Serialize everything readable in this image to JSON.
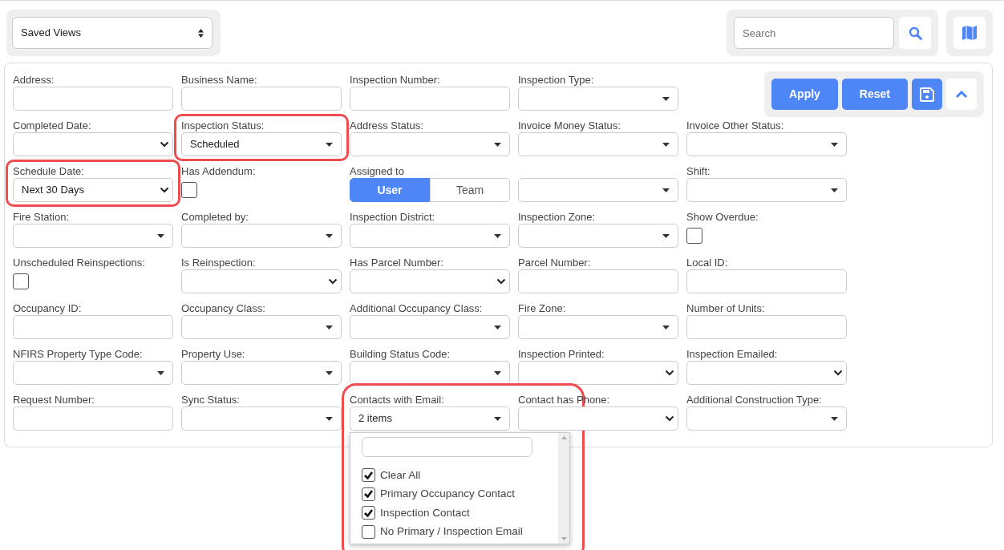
{
  "toolbar": {
    "saved_views": {
      "value": "Saved Views"
    },
    "search": {
      "placeholder": "Search"
    }
  },
  "filters": {
    "rows": [
      [
        {
          "label": "Address:",
          "kind": "text"
        },
        {
          "label": "Business Name:",
          "kind": "text"
        },
        {
          "label": "Inspection Number:",
          "kind": "text"
        },
        {
          "label": "Inspection Type:",
          "kind": "select"
        }
      ],
      [
        {
          "label": "Completed Date:",
          "kind": "native"
        },
        {
          "label": "Inspection Status:",
          "kind": "select",
          "value": "Scheduled",
          "highlighted": true
        },
        {
          "label": "Address Status:",
          "kind": "select"
        },
        {
          "label": "Invoice Money Status:",
          "kind": "select"
        },
        {
          "label": "Invoice Other Status:",
          "kind": "select"
        }
      ],
      [
        {
          "label": "Schedule Date:",
          "kind": "native",
          "value": "Next 30 Days",
          "highlighted": true
        },
        {
          "label": "Has Addendum:",
          "kind": "checkbox",
          "checked": false
        },
        {
          "label": "Assigned to",
          "kind": "toggle",
          "options": [
            {
              "label": "User",
              "selected": true
            },
            {
              "label": "Team",
              "selected": false
            }
          ]
        },
        {
          "kind": "select"
        },
        {
          "label": "Shift:",
          "kind": "select"
        }
      ],
      [
        {
          "label": "Fire Station:",
          "kind": "select"
        },
        {
          "label": "Completed by:",
          "kind": "select"
        },
        {
          "label": "Inspection District:",
          "kind": "select"
        },
        {
          "label": "Inspection Zone:",
          "kind": "select"
        },
        {
          "label": "Show Overdue:",
          "kind": "checkbox",
          "checked": false
        }
      ],
      [
        {
          "label": "Unscheduled Reinspections:",
          "kind": "checkbox",
          "checked": false
        },
        {
          "label": "Is Reinspection:",
          "kind": "native"
        },
        {
          "label": "Has Parcel Number:",
          "kind": "native"
        },
        {
          "label": "Parcel Number:",
          "kind": "text"
        },
        {
          "label": "Local ID:",
          "kind": "text"
        }
      ],
      [
        {
          "label": "Occupancy ID:",
          "kind": "text"
        },
        {
          "label": "Occupancy Class:",
          "kind": "select"
        },
        {
          "label": "Additional Occupancy Class:",
          "kind": "select"
        },
        {
          "label": "Fire Zone:",
          "kind": "select"
        },
        {
          "label": "Number of Units:",
          "kind": "text"
        }
      ],
      [
        {
          "label": "NFIRS Property Type Code:",
          "kind": "select"
        },
        {
          "label": "Property Use:",
          "kind": "select"
        },
        {
          "label": "Building Status Code:",
          "kind": "select"
        },
        {
          "label": "Inspection Printed:",
          "kind": "native"
        },
        {
          "label": "Inspection Emailed:",
          "kind": "native"
        }
      ],
      [
        {
          "label": "Request Number:",
          "kind": "text"
        },
        {
          "label": "Sync Status:",
          "kind": "select"
        },
        {
          "label": "Contacts with Email:",
          "kind": "select",
          "value": "2 items",
          "highlighted": true,
          "expanded": true,
          "dropdown": {
            "items": [
              {
                "label": "Clear All",
                "checked": true
              },
              {
                "label": "Primary Occupancy Contact",
                "checked": true
              },
              {
                "label": "Inspection Contact",
                "checked": true
              },
              {
                "label": "No Primary / Inspection Email",
                "checked": false
              }
            ]
          }
        },
        {
          "label": "Contact has Phone:",
          "kind": "native"
        },
        {
          "label": "Additional Construction Type:",
          "kind": "select"
        }
      ]
    ]
  },
  "actions": [
    {
      "label": "Apply",
      "kind": "text"
    },
    {
      "label": "Reset",
      "kind": "text"
    },
    {
      "kind": "save"
    },
    {
      "kind": "collapse"
    }
  ]
}
